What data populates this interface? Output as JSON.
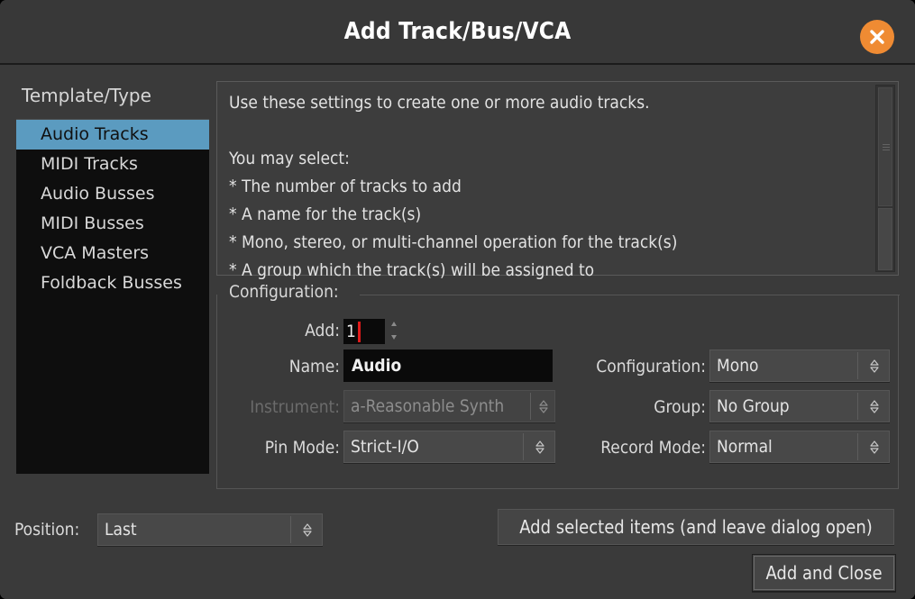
{
  "window": {
    "title": "Add Track/Bus/VCA",
    "close_icon": "close-x-icon",
    "accent_color": "#ef8b33",
    "selection_color": "#5b9bc0",
    "background_color": "#3a3a3a"
  },
  "sidebar": {
    "heading": "Template/Type",
    "items": [
      {
        "label": "Audio Tracks",
        "selected": true
      },
      {
        "label": "MIDI Tracks",
        "selected": false
      },
      {
        "label": "Audio Busses",
        "selected": false
      },
      {
        "label": "MIDI Busses",
        "selected": false
      },
      {
        "label": "VCA Masters",
        "selected": false
      },
      {
        "label": "Foldback Busses",
        "selected": false
      }
    ]
  },
  "description": {
    "text": "Use these settings to create one or more audio tracks.\n\nYou may select:\n* The number of tracks to add\n* A name for the track(s)\n* Mono, stereo, or multi-channel operation for the track(s)\n* A group which the track(s) will be assigned to",
    "scrollbar": "vertical-scrollbar"
  },
  "configuration": {
    "legend": "Configuration:",
    "add": {
      "label": "Add:",
      "value": "1",
      "spinner_icon": "spinner-up-down-icon"
    },
    "name": {
      "label": "Name:",
      "value": "Audio",
      "placeholder": "Audio"
    },
    "instrument": {
      "label": "Instrument:",
      "value": "a-Reasonable Synth",
      "disabled": true,
      "chevron_icon": "chevron-up-down-icon"
    },
    "pin_mode": {
      "label": "Pin Mode:",
      "value": "Strict-I/O",
      "chevron_icon": "chevron-up-down-icon"
    },
    "channel_configuration": {
      "label": "Configuration:",
      "value": "Mono",
      "chevron_icon": "chevron-up-down-icon"
    },
    "group": {
      "label": "Group:",
      "value": "No Group",
      "chevron_icon": "chevron-up-down-icon"
    },
    "record_mode": {
      "label": "Record Mode:",
      "value": "Normal",
      "chevron_icon": "chevron-up-down-icon"
    }
  },
  "footer": {
    "position": {
      "label": "Position:",
      "value": "Last",
      "chevron_icon": "chevron-up-down-icon"
    },
    "add_selected_label": "Add selected items (and leave dialog open)",
    "add_and_close_label": "Add and Close"
  }
}
